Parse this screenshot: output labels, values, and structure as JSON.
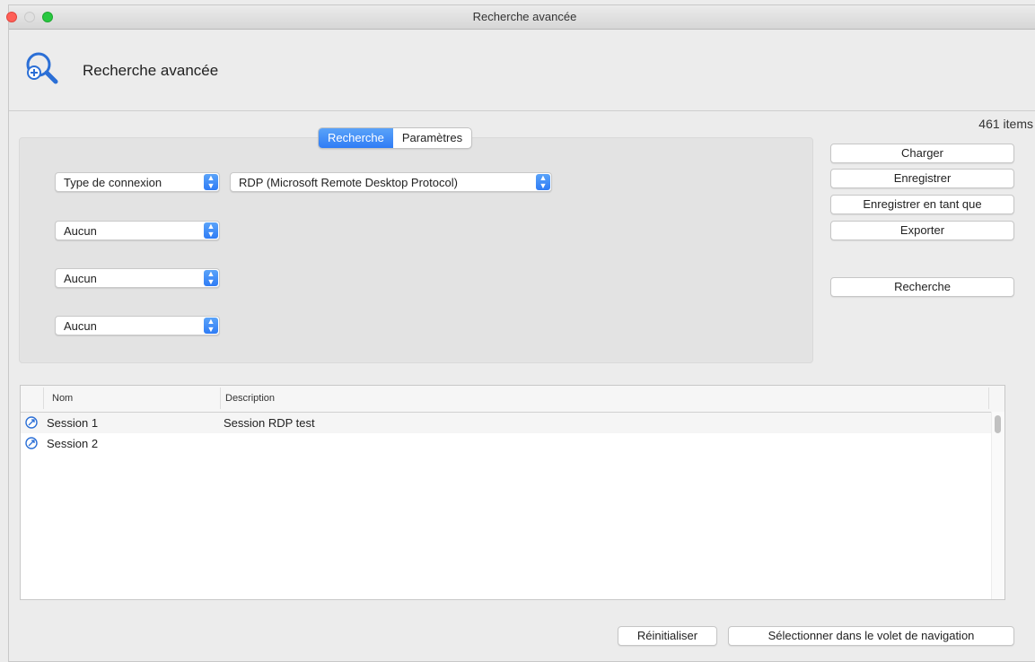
{
  "window": {
    "title": "Recherche avancée"
  },
  "header": {
    "title": "Recherche avancée",
    "icon": "search-plus-icon"
  },
  "count_text": "461 items",
  "tabs": [
    {
      "label": "Recherche",
      "active": true
    },
    {
      "label": "Paramètres",
      "active": false
    }
  ],
  "criteria": [
    {
      "field": "Type de connexion",
      "value": "RDP (Microsoft Remote Desktop Protocol)"
    },
    {
      "field": "Aucun"
    },
    {
      "field": "Aucun"
    },
    {
      "field": "Aucun"
    }
  ],
  "side_buttons": {
    "charger": "Charger",
    "enregistrer": "Enregistrer",
    "enregistrer_sous": "Enregistrer en tant que",
    "exporter": "Exporter",
    "recherche": "Recherche"
  },
  "table": {
    "columns": [
      "Nom",
      "Description"
    ],
    "rows": [
      {
        "name": "Session 1",
        "description": "Session RDP test",
        "icon": "rdp-session-icon"
      },
      {
        "name": "Session 2",
        "description": "",
        "icon": "rdp-session-icon"
      }
    ]
  },
  "footer": {
    "reset": "Réinitialiser",
    "select_nav": "Sélectionner dans le volet de navigation"
  },
  "colors": {
    "accent": "#2f7cf5",
    "icon_blue": "#2b6fd6"
  }
}
